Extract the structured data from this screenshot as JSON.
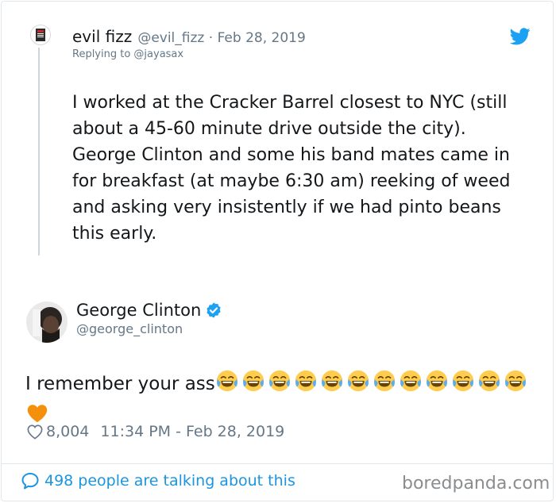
{
  "reply_tweet": {
    "display_name": "evil fizz",
    "handle": "@evil_fizz",
    "separator": " · ",
    "date": "Feb 28, 2019",
    "replying_to": "Replying to @jayasax",
    "text": "I worked at the Cracker Barrel closest to NYC (still about a 45-60 minute drive outside the city). George Clinton and some his band mates came in for breakfast (at maybe 6:30 am) reeking of weed and asking very insistently if we had pinto beans this early."
  },
  "main_tweet": {
    "display_name": "George Clinton",
    "handle": "@george_clinton",
    "text": "I remember your ass",
    "emojis": [
      "face-with-tears-of-joy",
      "face-with-tears-of-joy",
      "face-with-tears-of-joy",
      "face-with-tears-of-joy",
      "face-with-tears-of-joy",
      "face-with-tears-of-joy",
      "face-with-tears-of-joy",
      "face-with-tears-of-joy",
      "face-with-tears-of-joy",
      "face-with-tears-of-joy",
      "face-with-tears-of-joy",
      "face-with-tears-of-joy",
      "orange-heart"
    ],
    "likes": "8,004",
    "timestamp": "11:34 PM - Feb 28, 2019"
  },
  "footer": {
    "conversation": "498 people are talking about this"
  },
  "watermark": "boredpanda.com",
  "colors": {
    "link": "#1b95e0",
    "muted": "#657786",
    "text": "#14171a",
    "twitter_blue": "#1da1f2",
    "border": "#e1e8ed"
  },
  "icons": [
    "twitter-bird-icon",
    "verified-badge-icon",
    "heart-icon",
    "speech-bubble-icon"
  ]
}
